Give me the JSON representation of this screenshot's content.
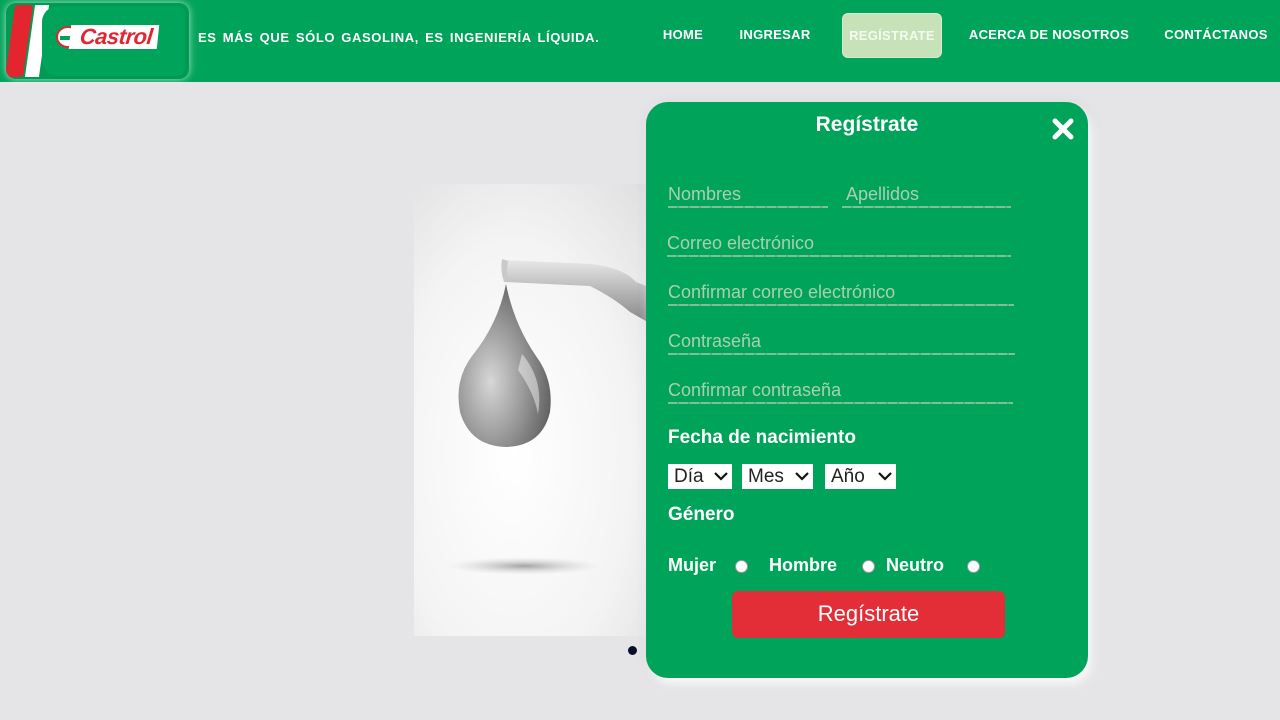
{
  "header": {
    "logo_text": "Castrol",
    "tagline": "ES MÁS QUE SÓLO GASOLINA, ES INGENIERÍA LÍQUIDA.",
    "nav": [
      {
        "label": "HOME",
        "active": false
      },
      {
        "label": "INGRESAR",
        "active": false
      },
      {
        "label": "REGÍSTRATE",
        "active": true
      },
      {
        "label": "ACERCA DE NOSOTROS",
        "active": false
      },
      {
        "label": "CONTÁCTANOS",
        "active": false
      }
    ]
  },
  "slider": {
    "image_description": "oil-drop-from-nozzle"
  },
  "modal": {
    "title": "Regístrate",
    "fields": {
      "first_name": {
        "placeholder": "Nombres",
        "value": ""
      },
      "last_name": {
        "placeholder": "Apellidos",
        "value": ""
      },
      "email": {
        "placeholder": "Correo electrónico",
        "value": ""
      },
      "email_confirm": {
        "placeholder": "Confirmar correo electrónico",
        "value": ""
      },
      "password": {
        "placeholder": "Contraseña",
        "value": ""
      },
      "password_confirm": {
        "placeholder": "Confirmar contraseña",
        "value": ""
      }
    },
    "birth_label": "Fecha de nacimiento",
    "birth_selects": {
      "day": "Día",
      "month": "Mes",
      "year": "Año"
    },
    "gender_label": "Género",
    "gender_options": [
      "Mujer",
      "Hombre",
      "Neutro"
    ],
    "submit_label": "Regístrate"
  },
  "colors": {
    "brand_green": "#00a35a",
    "brand_red": "#e32d37",
    "active_nav": "#c7e1b9",
    "page_bg": "#e5e5e7"
  }
}
